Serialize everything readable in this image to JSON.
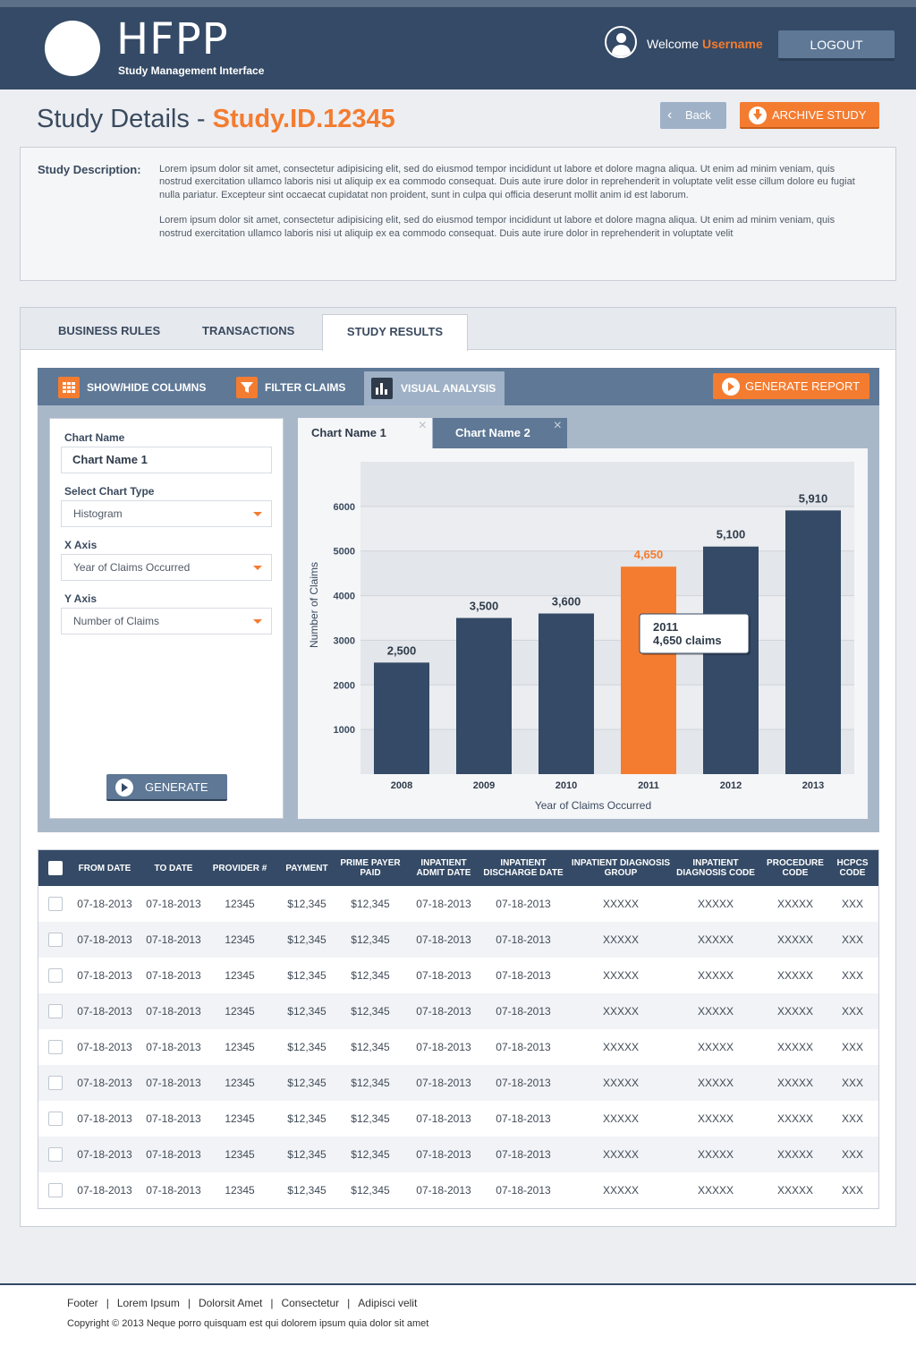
{
  "header": {
    "logo_text": "HFPP",
    "logo_sub": "Study Management Interface",
    "welcome": "Welcome",
    "username": "Username",
    "logout_label": "LOGOUT"
  },
  "page": {
    "title_prefix": "Study Details - ",
    "study_id": "Study.ID.12345",
    "back_label": "Back",
    "archive_label": "ARCHIVE STUDY"
  },
  "description": {
    "label": "Study Description:",
    "para1": "Lorem ipsum dolor sit amet, consectetur adipisicing elit, sed do eiusmod tempor incididunt ut labore et dolore magna aliqua. Ut enim ad minim veniam, quis nostrud exercitation ullamco laboris nisi ut aliquip ex ea commodo consequat. Duis aute irure dolor in reprehenderit in voluptate velit esse cillum dolore eu fugiat nulla pariatur. Excepteur sint occaecat cupidatat non proident, sunt in culpa qui officia deserunt mollit anim id est laborum.",
    "para2": "Lorem ipsum dolor sit amet, consectetur adipisicing elit, sed do eiusmod tempor incididunt ut labore et dolore magna aliqua. Ut enim ad minim veniam, quis nostrud exercitation ullamco laboris nisi ut aliquip ex ea commodo consequat. Duis aute irure dolor in reprehenderit in voluptate velit"
  },
  "tabs": [
    {
      "label": "BUSINESS RULES",
      "active": false
    },
    {
      "label": "TRANSACTIONS",
      "active": false
    },
    {
      "label": "STUDY RESULTS",
      "active": true
    }
  ],
  "toolbar": {
    "show_hide": "SHOW/HIDE COLUMNS",
    "filter": "FILTER CLAIMS",
    "visual": "VISUAL ANALYSIS",
    "generate_report": "GENERATE REPORT"
  },
  "form": {
    "chart_name_label": "Chart Name",
    "chart_name_value": "Chart Name 1",
    "chart_type_label": "Select Chart Type",
    "chart_type_value": "Histogram",
    "x_axis_label": "X Axis",
    "x_axis_value": "Year of Claims Occurred",
    "y_axis_label": "Y Axis",
    "y_axis_value": "Number of Claims",
    "generate_label": "GENERATE"
  },
  "chart_tabs": [
    "Chart Name 1",
    "Chart Name 2"
  ],
  "chart_data": {
    "type": "bar",
    "categories": [
      "2008",
      "2009",
      "2010",
      "2011",
      "2012",
      "2013"
    ],
    "values": [
      2500,
      3500,
      3600,
      4650,
      5100,
      5910
    ],
    "value_labels": [
      "2,500",
      "3,500",
      "3,600",
      "4,650",
      "5,100",
      "5,910"
    ],
    "highlight_index": 3,
    "xlabel": "Year of Claims Occurred",
    "ylabel": "Number of Claims",
    "yticks": [
      1000,
      2000,
      3000,
      4000,
      5000,
      6000
    ],
    "ylim": [
      0,
      7000
    ],
    "grid": true,
    "bar_color": "#344a66",
    "highlight_color": "#f47c30",
    "tooltip": {
      "line1": "2011",
      "line2": "4,650 claims"
    }
  },
  "table": {
    "columns": [
      "FROM DATE",
      "TO DATE",
      "PROVIDER #",
      "PAYMENT",
      "PRIME PAYER PAID",
      "INPATIENT ADMIT DATE",
      "INPATIENT DISCHARGE DATE",
      "INPATIENT DIAGNOSIS GROUP",
      "INPATIENT DIAGNOSIS CODE",
      "PROCEDURE CODE",
      "HCPCS CODE"
    ],
    "rows": [
      [
        "07-18-2013",
        "07-18-2013",
        "12345",
        "$12,345",
        "$12,345",
        "07-18-2013",
        "07-18-2013",
        "XXXXX",
        "XXXXX",
        "XXXXX",
        "XXX"
      ],
      [
        "07-18-2013",
        "07-18-2013",
        "12345",
        "$12,345",
        "$12,345",
        "07-18-2013",
        "07-18-2013",
        "XXXXX",
        "XXXXX",
        "XXXXX",
        "XXX"
      ],
      [
        "07-18-2013",
        "07-18-2013",
        "12345",
        "$12,345",
        "$12,345",
        "07-18-2013",
        "07-18-2013",
        "XXXXX",
        "XXXXX",
        "XXXXX",
        "XXX"
      ],
      [
        "07-18-2013",
        "07-18-2013",
        "12345",
        "$12,345",
        "$12,345",
        "07-18-2013",
        "07-18-2013",
        "XXXXX",
        "XXXXX",
        "XXXXX",
        "XXX"
      ],
      [
        "07-18-2013",
        "07-18-2013",
        "12345",
        "$12,345",
        "$12,345",
        "07-18-2013",
        "07-18-2013",
        "XXXXX",
        "XXXXX",
        "XXXXX",
        "XXX"
      ],
      [
        "07-18-2013",
        "07-18-2013",
        "12345",
        "$12,345",
        "$12,345",
        "07-18-2013",
        "07-18-2013",
        "XXXXX",
        "XXXXX",
        "XXXXX",
        "XXX"
      ],
      [
        "07-18-2013",
        "07-18-2013",
        "12345",
        "$12,345",
        "$12,345",
        "07-18-2013",
        "07-18-2013",
        "XXXXX",
        "XXXXX",
        "XXXXX",
        "XXX"
      ],
      [
        "07-18-2013",
        "07-18-2013",
        "12345",
        "$12,345",
        "$12,345",
        "07-18-2013",
        "07-18-2013",
        "XXXXX",
        "XXXXX",
        "XXXXX",
        "XXX"
      ],
      [
        "07-18-2013",
        "07-18-2013",
        "12345",
        "$12,345",
        "$12,345",
        "07-18-2013",
        "07-18-2013",
        "XXXXX",
        "XXXXX",
        "XXXXX",
        "XXX"
      ]
    ]
  },
  "footer": {
    "links": [
      "Footer",
      "Lorem Ipsum",
      "Dolorsit Amet",
      "Consectetur",
      "Adipisci velit"
    ],
    "copyright": "Copyright © 2013 Neque porro quisquam est qui dolorem ipsum quia dolor sit amet"
  },
  "colors": {
    "navy": "#344a66",
    "accent": "#f47c30",
    "slate": "#5e7896"
  }
}
